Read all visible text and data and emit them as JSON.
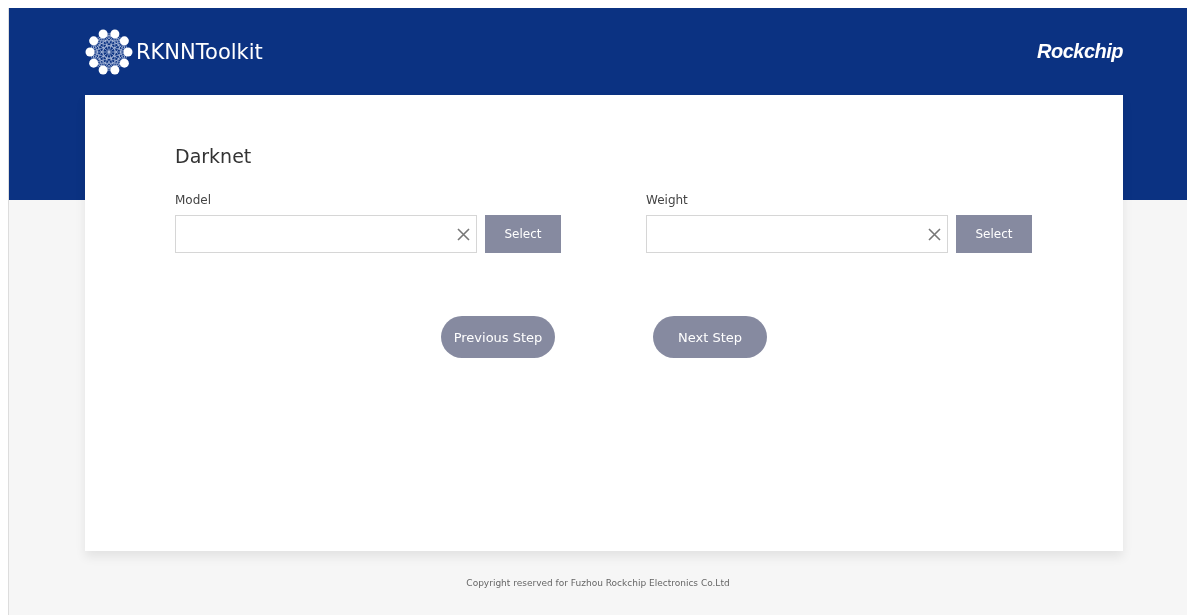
{
  "header": {
    "app_name": "RKNNToolkit",
    "brand": "Rockchip"
  },
  "form": {
    "title": "Darknet",
    "fields": [
      {
        "label": "Model",
        "button": "Select"
      },
      {
        "label": "Weight",
        "button": "Select"
      }
    ],
    "actions": [
      "Previous Step",
      "Next Step"
    ]
  },
  "footer": {
    "text": "Copyright reserved for Fuzhou Rockchip Electronics Co.Ltd"
  }
}
